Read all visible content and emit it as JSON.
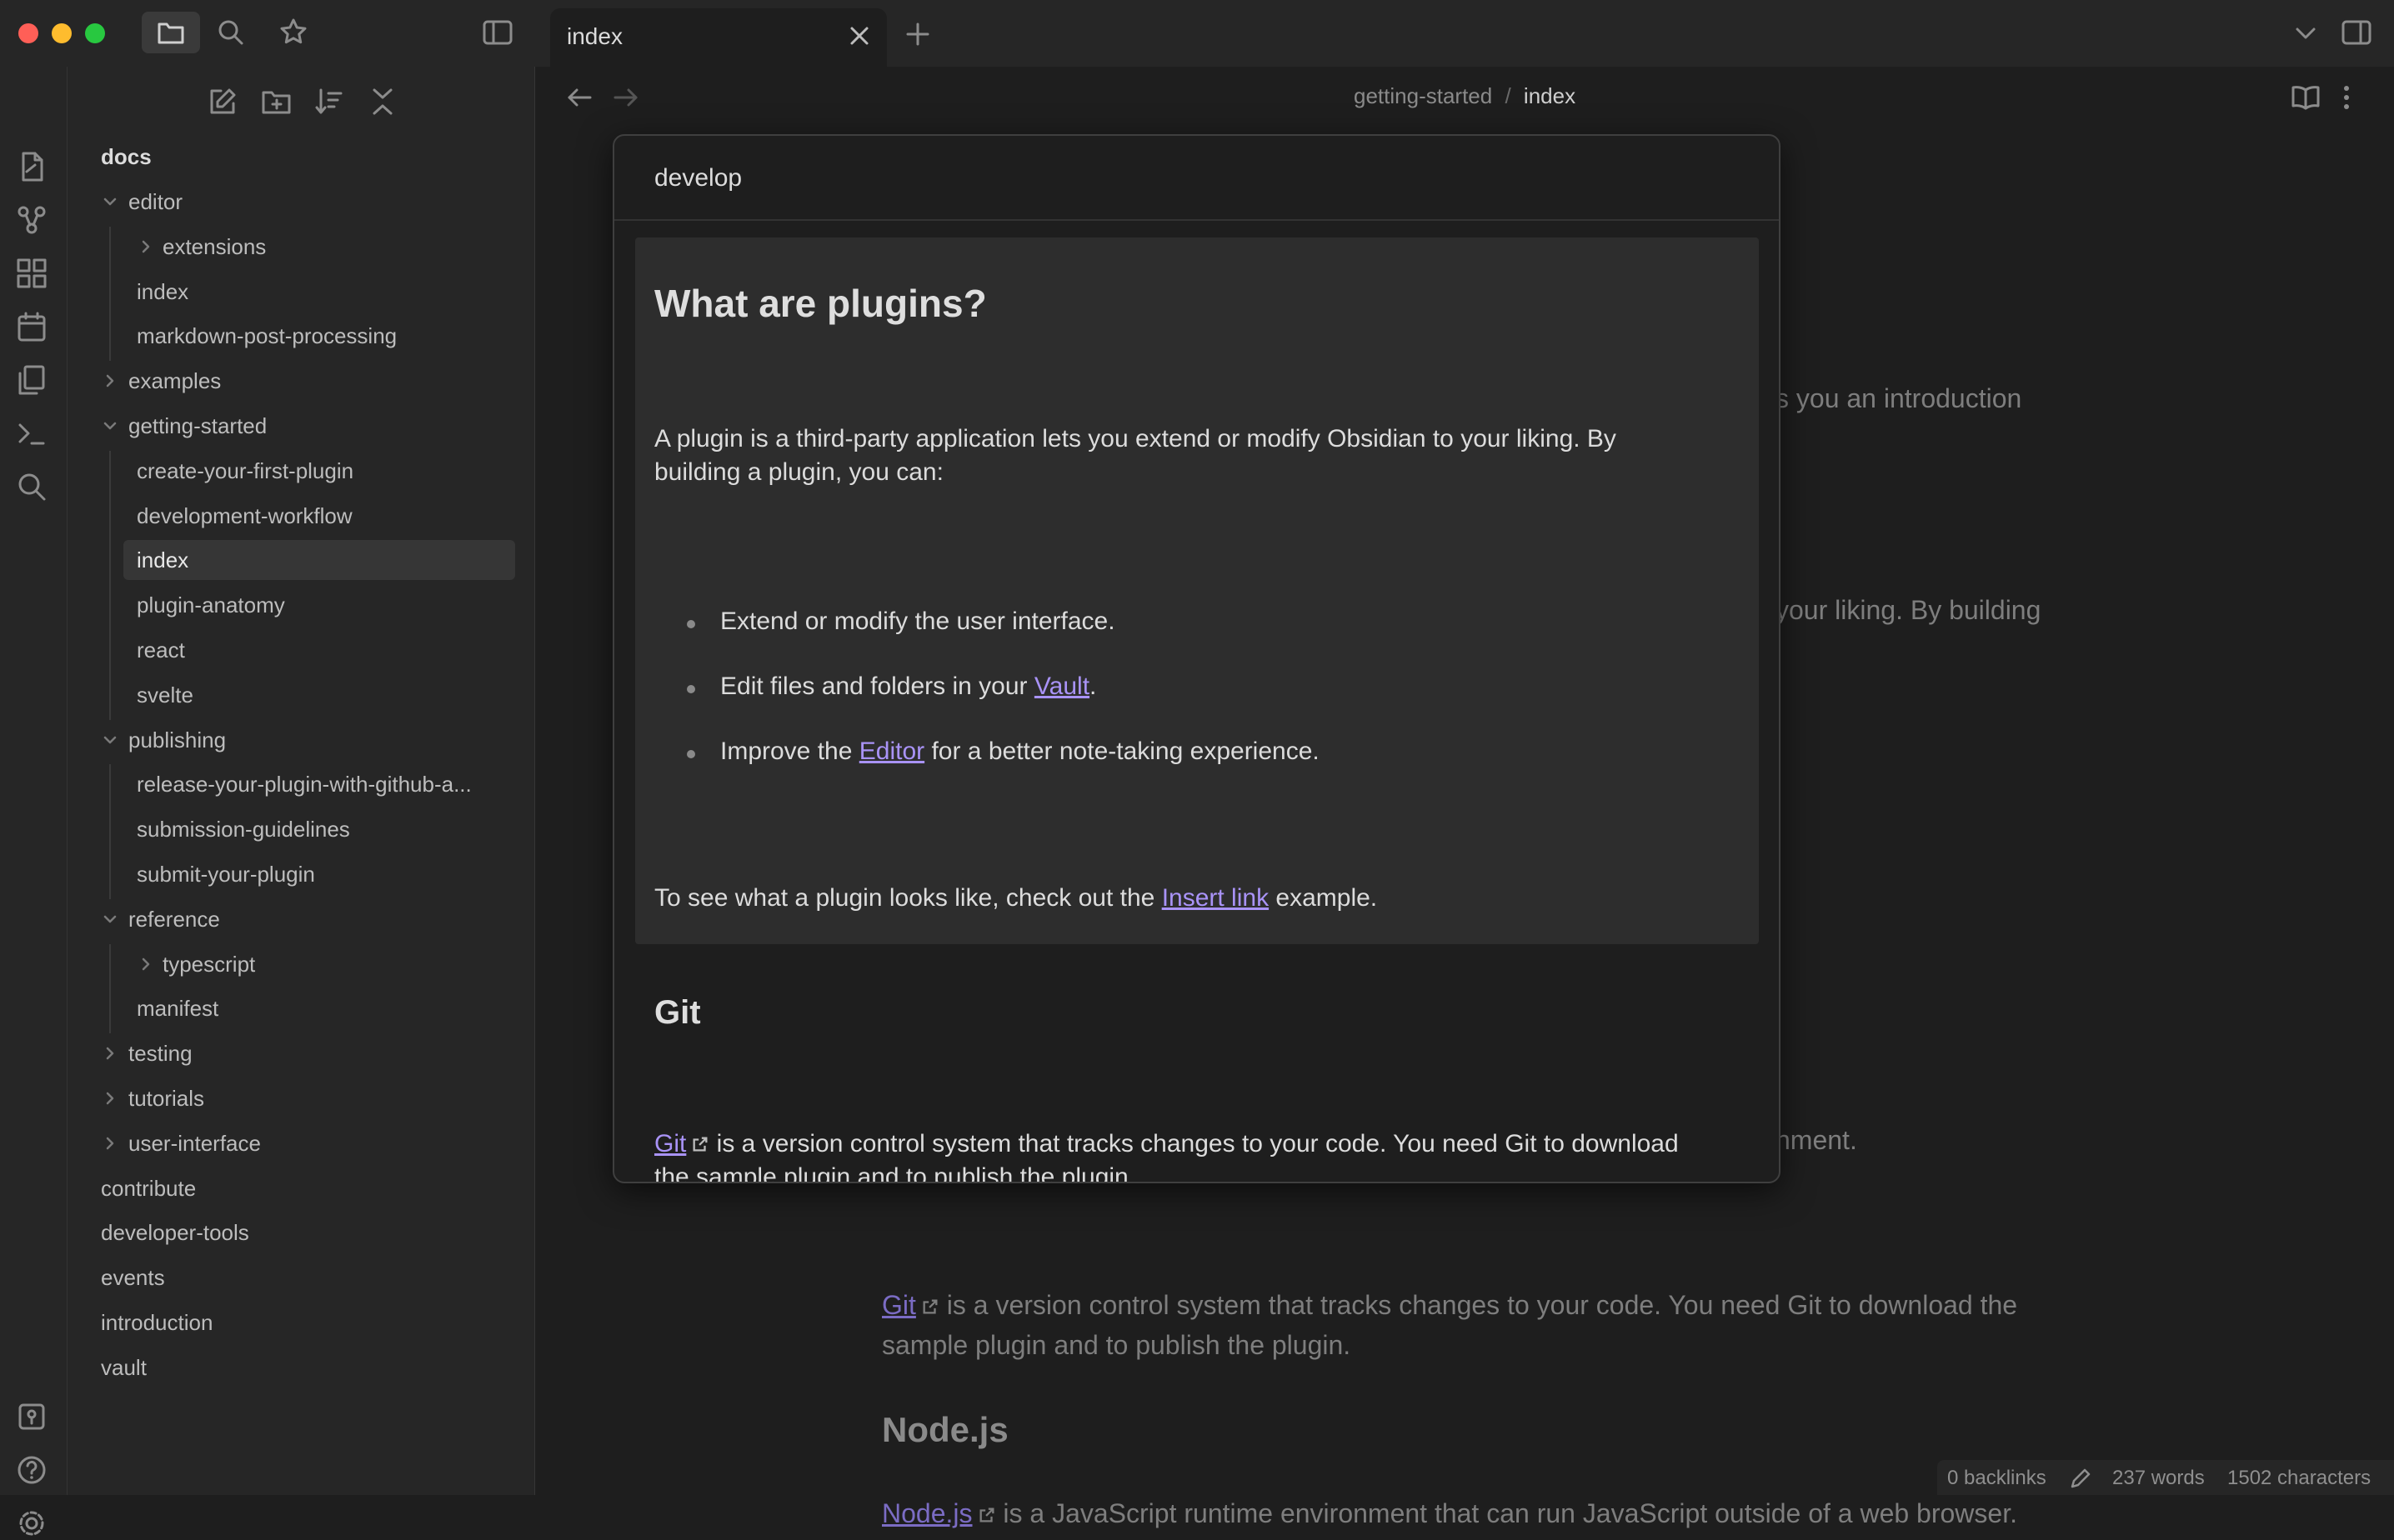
{
  "tab": {
    "title": "index"
  },
  "breadcrumb": {
    "parent": "getting-started",
    "separator": "/",
    "current": "index"
  },
  "sidebar": {
    "root": "docs",
    "tree": [
      {
        "label": "editor",
        "depth": 1,
        "chevron": "down"
      },
      {
        "label": "extensions",
        "depth": 2,
        "chevron": "right"
      },
      {
        "label": "index",
        "depth": 2,
        "chevron": ""
      },
      {
        "label": "markdown-post-processing",
        "depth": 2,
        "chevron": ""
      },
      {
        "label": "examples",
        "depth": 1,
        "chevron": "right"
      },
      {
        "label": "getting-started",
        "depth": 1,
        "chevron": "down"
      },
      {
        "label": "create-your-first-plugin",
        "depth": 2,
        "chevron": ""
      },
      {
        "label": "development-workflow",
        "depth": 2,
        "chevron": ""
      },
      {
        "label": "index",
        "depth": 2,
        "chevron": "",
        "active": true
      },
      {
        "label": "plugin-anatomy",
        "depth": 2,
        "chevron": ""
      },
      {
        "label": "react",
        "depth": 2,
        "chevron": ""
      },
      {
        "label": "svelte",
        "depth": 2,
        "chevron": ""
      },
      {
        "label": "publishing",
        "depth": 1,
        "chevron": "down"
      },
      {
        "label": "release-your-plugin-with-github-a...",
        "depth": 2,
        "chevron": ""
      },
      {
        "label": "submission-guidelines",
        "depth": 2,
        "chevron": ""
      },
      {
        "label": "submit-your-plugin",
        "depth": 2,
        "chevron": ""
      },
      {
        "label": "reference",
        "depth": 1,
        "chevron": "down"
      },
      {
        "label": "typescript",
        "depth": 2,
        "chevron": "right"
      },
      {
        "label": "manifest",
        "depth": 2,
        "chevron": ""
      },
      {
        "label": "testing",
        "depth": 1,
        "chevron": "right"
      },
      {
        "label": "tutorials",
        "depth": 1,
        "chevron": "right"
      },
      {
        "label": "user-interface",
        "depth": 1,
        "chevron": "right"
      },
      {
        "label": "contribute",
        "depth": 0,
        "chevron": ""
      },
      {
        "label": "developer-tools",
        "depth": 0,
        "chevron": ""
      },
      {
        "label": "events",
        "depth": 0,
        "chevron": ""
      },
      {
        "label": "introduction",
        "depth": 0,
        "chevron": ""
      },
      {
        "label": "vault",
        "depth": 0,
        "chevron": ""
      }
    ]
  },
  "background": {
    "line1": "s you an introduction",
    "line2": "your liking. By building",
    "line3": "nment.",
    "git_link": "Git",
    "git_text_1": " is a version control system that tracks changes to your code. You need Git to download the",
    "git_text_2": "sample plugin and to publish the plugin.",
    "node_heading": "Node.js",
    "node_link": "Node.js",
    "node_text": " is a JavaScript runtime environment that can run JavaScript outside of a web browser."
  },
  "popover": {
    "title": "develop",
    "heading": "What are plugins?",
    "intro_1": "A plugin is a third-party application lets you extend or modify Obsidian to your liking. By",
    "intro_2": "building a plugin, you can:",
    "bullet1": "Extend or modify the user interface.",
    "bullet2_pre": "Edit files and folders in your ",
    "bullet2_link": "Vault",
    "bullet2_post": ".",
    "bullet3_pre": "Improve the ",
    "bullet3_link": "Editor",
    "bullet3_post": " for a better note-taking experience.",
    "see_pre": "To see what a plugin looks like, check out the ",
    "see_link": "Insert link",
    "see_post": " example.",
    "git_heading": "Git",
    "git_link": "Git",
    "git_text_1": " is a version control system that tracks changes to your code. You need Git to download",
    "git_text_2": "the sample plugin and to publish the plugin."
  },
  "status": {
    "backlinks": "0 backlinks",
    "words": "237 words",
    "characters": "1502 characters"
  }
}
